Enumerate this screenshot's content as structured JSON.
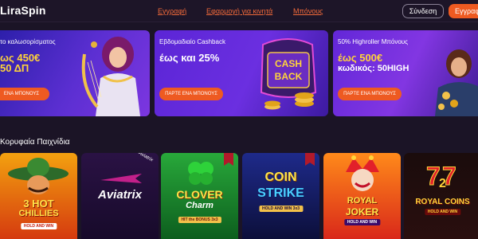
{
  "header": {
    "logo": "LiraSpin",
    "nav": [
      "Εγγραφή",
      "Εφαρμογή για κινητά",
      "Μπόνους"
    ],
    "login_label": "Σύνδεση",
    "register_label": "Εγγραφ"
  },
  "banners": [
    {
      "title": "το καλωσορίσματος",
      "line1": "ως 450€",
      "line2": "50 ΔΠ",
      "cta": "ΕΝΑ ΜΠΟΝΟΥΣ",
      "art_label": ""
    },
    {
      "title": "Εβδομαδιαίο Cashback",
      "line1": "έως και 25%",
      "line2": "",
      "cta": "ΠΑΡΤΕ ΕΝΑ ΜΠΟΝΟΥΣ",
      "art_label_1": "CASH",
      "art_label_2": "BACK"
    },
    {
      "title": "50% Highroller Μπόνους",
      "line1": "έως 500€",
      "line2": "κωδικός: 50HIGH",
      "cta": "ΠΑΡΤΕ ΕΝΑ ΜΠΟΝΟΥΣ"
    }
  ],
  "section_title": "Κορυφαία Παιχνίδια",
  "games": [
    {
      "name_line1": "3 HOT",
      "name_line2": "CHILLIES",
      "sub": "HOLD AND WIN"
    },
    {
      "name_line1": "Aviatrix",
      "corner": "Aviatrix"
    },
    {
      "name_line1": "CLOVER",
      "name_line2": "Charm",
      "sub": "HIT the BONUS 3x3"
    },
    {
      "name_line1": "COIN",
      "name_line2": "STRIKE",
      "sub": "HOLD AND WIN 3x3"
    },
    {
      "name_line1": "ROYAL",
      "name_line2": "JOKER",
      "sub": "HOLD AND WIN"
    },
    {
      "name_line1": "ROYAL COINS",
      "name_line2": "2",
      "sub": "HOLD AND WIN"
    }
  ],
  "colors": {
    "bg": "#1b1426",
    "accent": "#ee5a21",
    "nav_link": "#f26a3a",
    "promo_yellow": "#ffd43a"
  }
}
